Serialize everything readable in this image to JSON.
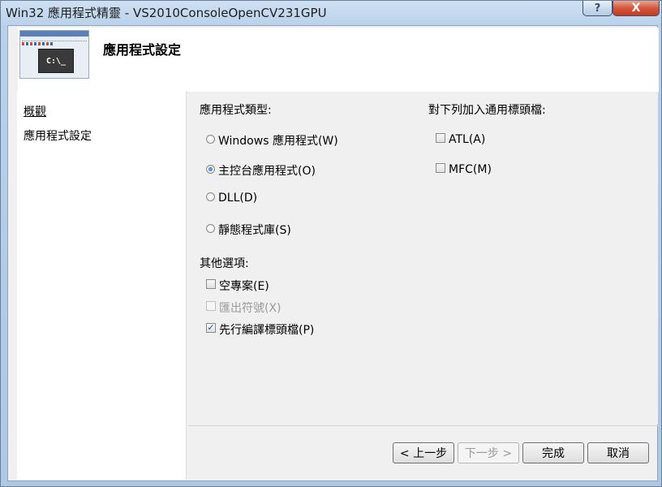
{
  "window": {
    "title": "Win32 應用程式精靈 - VS2010ConsoleOpenCV231GPU",
    "help_glyph": "?",
    "close_glyph": "X"
  },
  "header": {
    "title": "應用程式設定",
    "logo_console_text": "C:\\_"
  },
  "sidebar": {
    "items": [
      {
        "label": "概觀",
        "link": true
      },
      {
        "label": "應用程式設定",
        "link": false
      }
    ]
  },
  "app_type": {
    "label": "應用程式類型:",
    "options": [
      {
        "label": "Windows 應用程式(W)",
        "selected": false
      },
      {
        "label": "主控台應用程式(O)",
        "selected": true
      },
      {
        "label": "DLL(D)",
        "selected": false
      },
      {
        "label": "靜態程式庫(S)",
        "selected": false
      }
    ]
  },
  "headers": {
    "label": "對下列加入通用標頭檔:",
    "options": [
      {
        "label": "ATL(A)",
        "checked": false
      },
      {
        "label": "MFC(M)",
        "checked": false
      }
    ]
  },
  "other": {
    "label": "其他選項:",
    "options": [
      {
        "label": "空專案(E)",
        "checked": false,
        "enabled": true
      },
      {
        "label": "匯出符號(X)",
        "checked": false,
        "enabled": false
      },
      {
        "label": "先行編譯標頭檔(P)",
        "checked": true,
        "enabled": true
      }
    ]
  },
  "buttons": {
    "prev": "< 上一步",
    "next": "下一步 >",
    "finish": "完成",
    "cancel": "取消"
  },
  "check_glyph": "✓"
}
